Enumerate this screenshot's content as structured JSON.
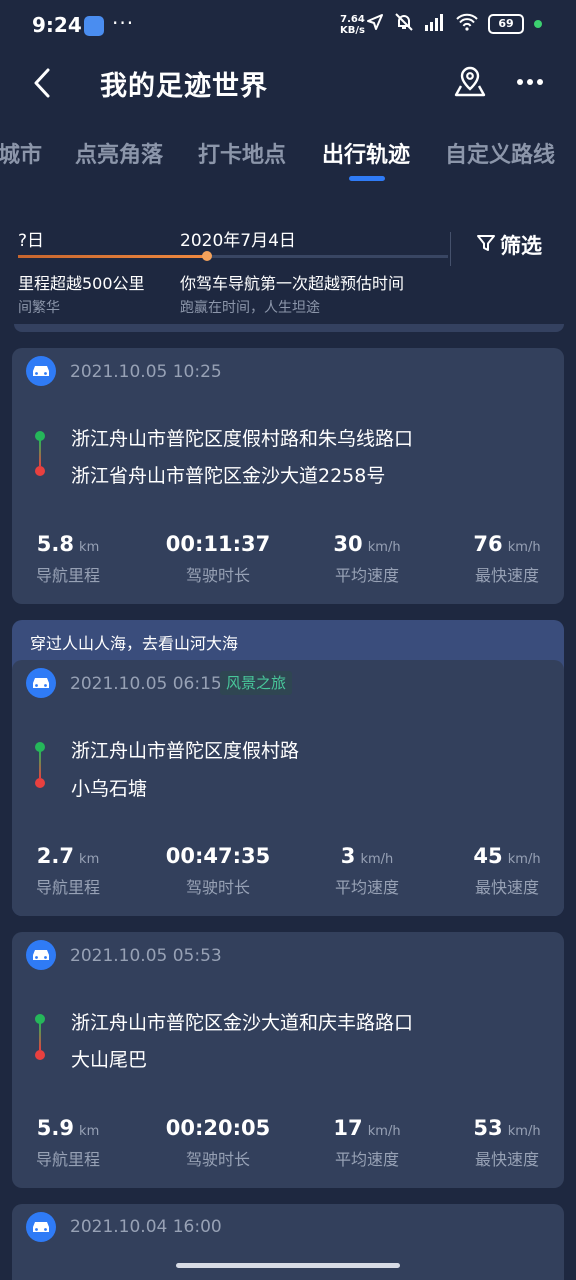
{
  "status_bar": {
    "time": "9:24",
    "dots": "···",
    "net_speed_value": "7.64",
    "net_speed_unit": "KB/s",
    "battery": "69"
  },
  "header": {
    "title": "我的足迹世界"
  },
  "tabs": [
    {
      "label": "城市",
      "active": false
    },
    {
      "label": "点亮角落",
      "active": false
    },
    {
      "label": "打卡地点",
      "active": false
    },
    {
      "label": "出行轨迹",
      "active": true
    },
    {
      "label": "自定义路线",
      "active": false
    }
  ],
  "timeline": {
    "progress": 0.44,
    "events": [
      {
        "date": "?日",
        "headline": "里程超越500公里",
        "sub": "间繁华"
      },
      {
        "date": "2020年7月4日",
        "headline": "你驾车导航第一次超越预估时间",
        "sub": "跑赢在时间，人生坦途"
      }
    ],
    "filter_label": "筛选"
  },
  "group": {
    "title": "穿过人山人海，去看山河大海"
  },
  "stat_labels": {
    "distance": "导航里程",
    "duration": "驾驶时长",
    "avg_speed": "平均速度",
    "max_speed": "最快速度"
  },
  "units": {
    "km": "km",
    "kmh": "km/h"
  },
  "trips": [
    {
      "time": "2021.10.05 10:25",
      "tag": "",
      "start": "浙江舟山市普陀区度假村路和朱乌线路口",
      "end": "浙江省舟山市普陀区金沙大道2258号",
      "distance": "5.8",
      "duration": "00:11:37",
      "avg_speed": "30",
      "max_speed": "76"
    },
    {
      "time": "2021.10.05 06:15",
      "tag": "风景之旅",
      "start": "浙江舟山市普陀区度假村路",
      "end": "小乌石塘",
      "distance": "2.7",
      "duration": "00:47:35",
      "avg_speed": "3",
      "max_speed": "45"
    },
    {
      "time": "2021.10.05 05:53",
      "tag": "",
      "start": "浙江舟山市普陀区金沙大道和庆丰路路口",
      "end": "大山尾巴",
      "distance": "5.9",
      "duration": "00:20:05",
      "avg_speed": "17",
      "max_speed": "53"
    },
    {
      "time": "2021.10.04 16:00"
    }
  ]
}
